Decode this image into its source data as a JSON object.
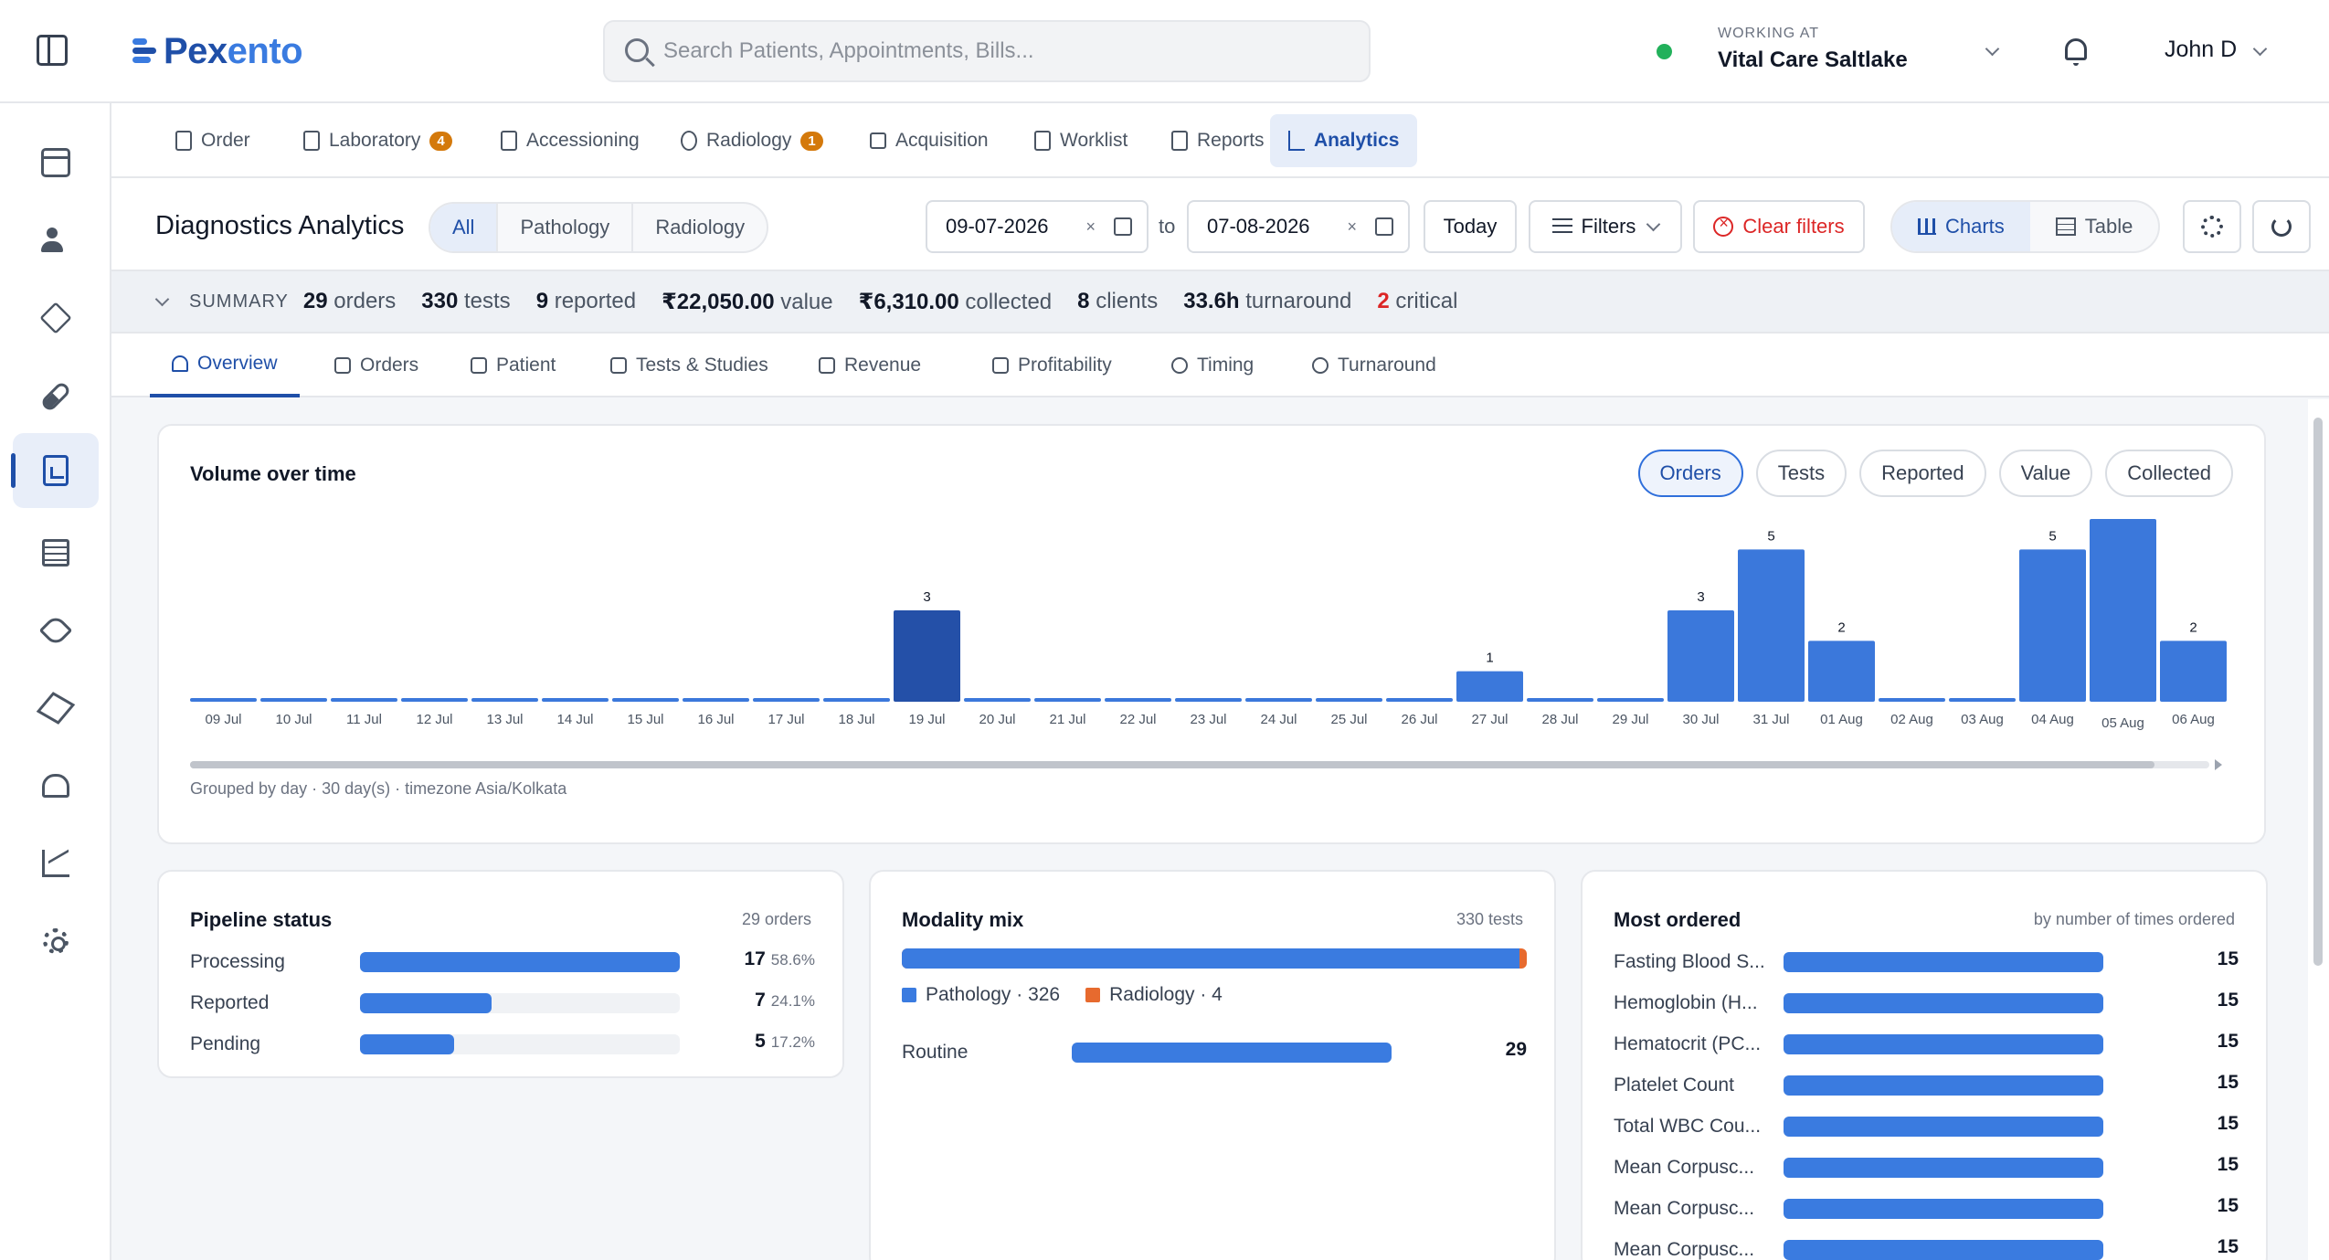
{
  "app": {
    "brand_prefix": "Pex",
    "brand_suffix": "ento",
    "search_placeholder": "Search Patients, Appointments, Bills...",
    "working_label": "WORKING AT",
    "working_value": "Vital Care Saltlake",
    "user_name": "John D"
  },
  "sidebar": {
    "items": [
      {
        "icon": "calendar-icon"
      },
      {
        "icon": "users-icon"
      },
      {
        "icon": "cubes-icon"
      },
      {
        "icon": "pill-icon"
      },
      {
        "icon": "report-icon",
        "active": true
      },
      {
        "icon": "list-icon"
      },
      {
        "icon": "tag-icon"
      },
      {
        "icon": "package-icon"
      },
      {
        "icon": "heart-pulse-icon"
      },
      {
        "icon": "trend-icon"
      },
      {
        "icon": "settings-icon"
      }
    ]
  },
  "modules": [
    {
      "label": "Order"
    },
    {
      "label": "Laboratory",
      "badge": "4"
    },
    {
      "label": "Accessioning"
    },
    {
      "label": "Radiology",
      "badge": "1"
    },
    {
      "label": "Acquisition"
    },
    {
      "label": "Worklist"
    },
    {
      "label": "Reports"
    },
    {
      "label": "Analytics",
      "active": true
    }
  ],
  "toolbar": {
    "title": "Diagnostics Analytics",
    "scope": [
      "All",
      "Pathology",
      "Radiology"
    ],
    "from_date": "09-07-2026",
    "to_label": "to",
    "to_date": "07-08-2026",
    "clear_glyph": "×",
    "today_label": "Today",
    "filters_label": "Filters",
    "clear_filters_label": "Clear filters",
    "charts_label": "Charts",
    "table_label": "Table"
  },
  "summary": {
    "label": "SUMMARY",
    "orders": "29",
    "orders_unit": "orders",
    "tests": "330",
    "tests_unit": "tests",
    "reported": "9",
    "reported_unit": "reported",
    "value": "₹22,050.00",
    "value_unit": "value",
    "collected": "₹6,310.00",
    "collected_unit": "collected",
    "clients": "8",
    "clients_unit": "clients",
    "turnaround": "33.6h",
    "turnaround_unit": "turnaround",
    "critical": "2",
    "critical_unit": "critical"
  },
  "sections": [
    "Overview",
    "Orders",
    "Patient",
    "Tests & Studies",
    "Revenue",
    "Profitability",
    "Timing",
    "Turnaround"
  ],
  "volume": {
    "title": "Volume over time",
    "metrics": [
      "Orders",
      "Tests",
      "Reported",
      "Value",
      "Collected"
    ],
    "footer": "Grouped by day · 30 day(s) · timezone Asia/Kolkata"
  },
  "chart_data": {
    "type": "bar",
    "categories": [
      "09 Jul",
      "10 Jul",
      "11 Jul",
      "12 Jul",
      "13 Jul",
      "14 Jul",
      "15 Jul",
      "16 Jul",
      "17 Jul",
      "18 Jul",
      "19 Jul",
      "20 Jul",
      "21 Jul",
      "22 Jul",
      "23 Jul",
      "24 Jul",
      "25 Jul",
      "26 Jul",
      "27 Jul",
      "28 Jul",
      "29 Jul",
      "30 Jul",
      "31 Jul",
      "01 Aug",
      "02 Aug",
      "03 Aug",
      "04 Aug",
      "05 Aug",
      "06 Aug"
    ],
    "values": [
      0,
      0,
      0,
      0,
      0,
      0,
      0,
      0,
      0,
      0,
      3,
      0,
      0,
      0,
      0,
      0,
      0,
      0,
      1,
      0,
      0,
      3,
      5,
      2,
      0,
      0,
      5,
      6,
      2
    ],
    "ylim": [
      0,
      6
    ],
    "colors": {
      "bar": "#3b78db",
      "highlight": "#2450a8"
    }
  },
  "pipeline": {
    "title": "Pipeline status",
    "subtitle": "29 orders",
    "rows": [
      {
        "label": "Processing",
        "value": "17",
        "pct": "58.6%",
        "fraction": 0.586
      },
      {
        "label": "Reported",
        "value": "7",
        "pct": "24.1%",
        "fraction": 0.241
      },
      {
        "label": "Pending",
        "value": "5",
        "pct": "17.2%",
        "fraction": 0.172
      }
    ]
  },
  "modality": {
    "title": "Modality mix",
    "subtitle": "330 tests",
    "pathology_label": "Pathology · 326",
    "radiology_label": "Radiology · 4",
    "pathology_fraction": 0.988,
    "routine_label": "Routine",
    "routine_value": "29",
    "routine_fraction": 1.0
  },
  "most_ordered": {
    "title": "Most ordered",
    "subtitle": "by number of times ordered",
    "rows": [
      {
        "label": "Fasting Blood S...",
        "value": "15"
      },
      {
        "label": "Hemoglobin (H...",
        "value": "15"
      },
      {
        "label": "Hematocrit (PC...",
        "value": "15"
      },
      {
        "label": "Platelet Count",
        "value": "15"
      },
      {
        "label": "Total WBC Cou...",
        "value": "15"
      },
      {
        "label": "Mean Corpusc...",
        "value": "15"
      },
      {
        "label": "Mean Corpusc...",
        "value": "15"
      },
      {
        "label": "Mean Corpusc...",
        "value": "15"
      }
    ]
  }
}
